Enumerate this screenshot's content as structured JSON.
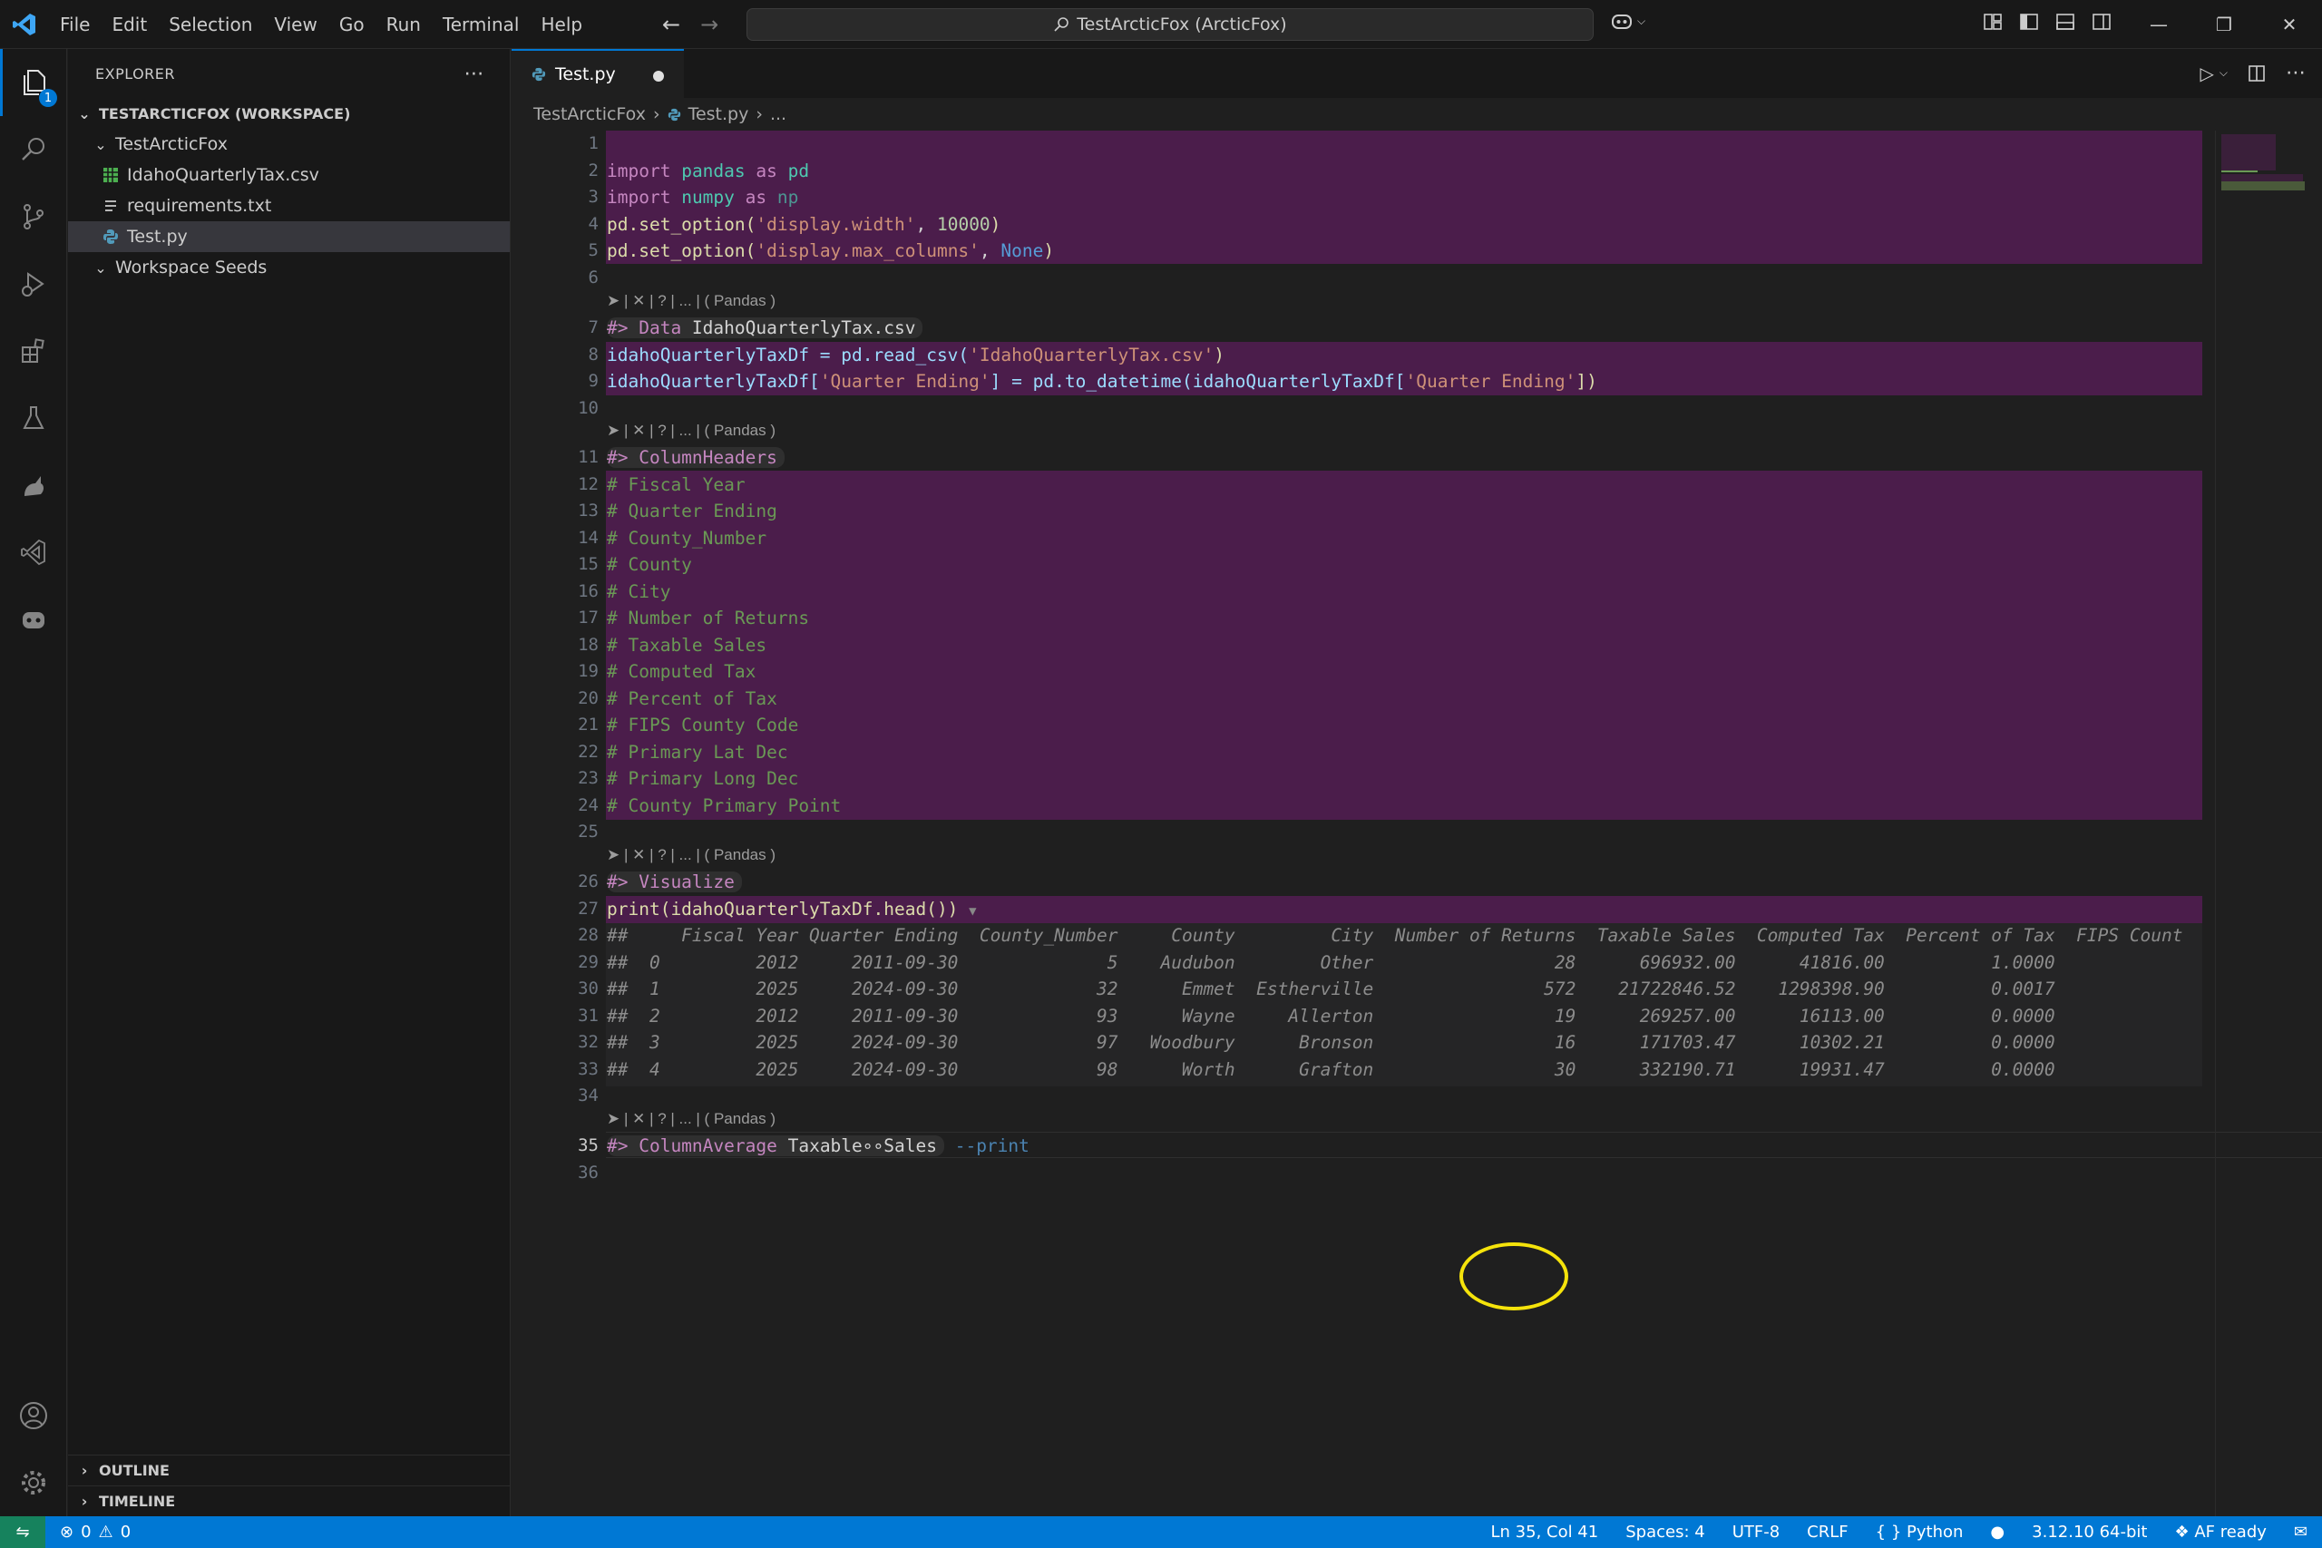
{
  "window": {
    "menu": [
      "File",
      "Edit",
      "Selection",
      "View",
      "Go",
      "Run",
      "Terminal",
      "Help"
    ],
    "command_center": "TestArcticFox (ArcticFox)"
  },
  "activity_bar": {
    "explorer_badge": "1",
    "items": [
      "files-icon",
      "search-icon",
      "source-control-icon",
      "run-debug-icon",
      "extensions-icon",
      "testing-icon",
      "arcticfox-icon",
      "visual-studio-icon",
      "copilot-icon"
    ],
    "bottom": [
      "account-icon",
      "settings-gear-icon"
    ]
  },
  "sidebar": {
    "title": "EXPLORER",
    "workspace": "TESTARCTICFOX (WORKSPACE)",
    "folder": "TestArcticFox",
    "files": [
      {
        "name": "IdahoQuarterlyTax.csv",
        "icon": "csv-icon",
        "color": "#4caf50"
      },
      {
        "name": "requirements.txt",
        "icon": "text-file-icon",
        "color": "#cccccc"
      },
      {
        "name": "Test.py",
        "icon": "python-icon",
        "color": "#519aba"
      }
    ],
    "folder2": "Workspace Seeds",
    "outline": "OUTLINE",
    "timeline": "TIMELINE"
  },
  "editor": {
    "tab": "Test.py",
    "breadcrumb": [
      "TestArcticFox",
      "Test.py",
      "..."
    ],
    "cell_header": "➤ | ✕ | ? | ... | ( Pandas )",
    "line_numbers": [
      "1",
      "2",
      "3",
      "4",
      "5",
      "6",
      "7",
      "8",
      "9",
      "10",
      "11",
      "12",
      "13",
      "14",
      "15",
      "16",
      "17",
      "18",
      "19",
      "20",
      "21",
      "22",
      "23",
      "24",
      "25",
      "26",
      "27",
      "28",
      "29",
      "30",
      "31",
      "32",
      "33",
      "34",
      "35",
      "36"
    ],
    "code": {
      "l2": [
        "import",
        "pandas",
        "as",
        "pd"
      ],
      "l3": [
        "import",
        "numpy",
        "as",
        "np"
      ],
      "l4": [
        "pd.set_option(",
        "'display.width'",
        ", ",
        "10000",
        ")"
      ],
      "l5": [
        "pd.set_option(",
        "'display.max_columns'",
        ", ",
        "None",
        ")"
      ],
      "l7": [
        "#> Data ",
        "IdahoQuarterlyTax.csv"
      ],
      "l8": [
        "idahoQuarterlyTaxDf = pd.read_csv(",
        "'IdahoQuarterlyTax.csv'",
        ")"
      ],
      "l9": [
        "idahoQuarterlyTaxDf[",
        "'Quarter Ending'",
        "] = pd.to_datetime(idahoQuarterlyTaxDf[",
        "'Quarter Ending'",
        "])"
      ],
      "l11": "#> ColumnHeaders",
      "comments": [
        "# Fiscal Year",
        "# Quarter Ending",
        "# County_Number",
        "# County",
        "# City",
        "# Number of Returns",
        "# Taxable Sales",
        "# Computed Tax",
        "# Percent of Tax",
        "# FIPS County Code",
        "# Primary Lat Dec",
        "# Primary Long Dec",
        "# County Primary Point"
      ],
      "l26": "#> Visualize",
      "l27": "print(idahoQuarterlyTaxDf.head())",
      "output": [
        "##     Fiscal Year Quarter Ending  County_Number     County         City  Number of Returns  Taxable Sales  Computed Tax  Percent of Tax  FIPS Count",
        "##  0         2012     2011-09-30              5    Audubon        Other                 28      696932.00      41816.00          1.0000",
        "##  1         2025     2024-09-30             32      Emmet  Estherville                572    21722846.52    1298398.90          0.0017",
        "##  2         2012     2011-09-30             93      Wayne     Allerton                 19      269257.00      16113.00          0.0000",
        "##  3         2025     2024-09-30             97   Woodbury      Bronson                 16      171703.47      10302.21          0.0000",
        "##  4         2025     2024-09-30             98      Worth      Grafton                 30      332190.71      19931.47          0.0000"
      ],
      "l35": [
        "#> ColumnAverage ",
        "Taxable∘∘Sales",
        " --print"
      ]
    }
  },
  "statusbar": {
    "problems": "0",
    "warnings": "0",
    "position": "Ln 35, Col 41",
    "spaces": "Spaces: 4",
    "encoding": "UTF-8",
    "eol": "CRLF",
    "language": "Python",
    "interpreter": "3.12.10 64-bit",
    "af": "AF ready"
  }
}
